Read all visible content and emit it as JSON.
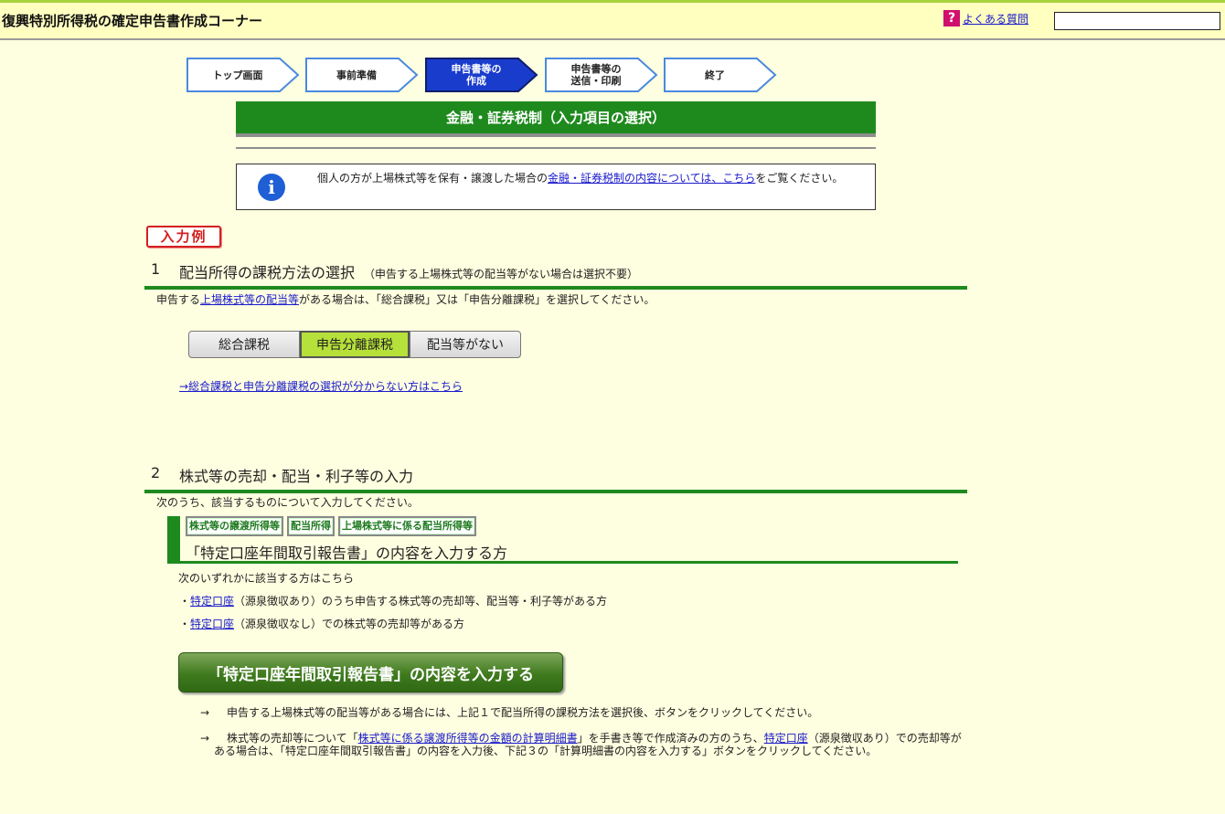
{
  "header": {
    "title": "復興特別所得税の確定申告書作成コーナー",
    "faq_label": "よくある質問",
    "search_value": ""
  },
  "steps": [
    {
      "label": "トップ画面",
      "active": false
    },
    {
      "label": "事前準備",
      "active": false
    },
    {
      "label": "申告書等の\n作成",
      "active": true
    },
    {
      "label": "申告書等の\n送信・印刷",
      "active": false
    },
    {
      "label": "終了",
      "active": false
    }
  ],
  "page_title": "金融・証券税制（入力項目の選択）",
  "info": {
    "text_before": "個人の方が上場株式等を保有・譲渡した場合の",
    "link": "金融・証券税制の内容については、こちら",
    "text_after": "をご覧ください。"
  },
  "example_badge": "入力例",
  "section1": {
    "number": "1",
    "heading": "配当所得の課税方法の選択",
    "note": "（申告する上場株式等の配当等がない場合は選択不要）",
    "desc_before": "申告する",
    "desc_link": "上場株式等の配当等",
    "desc_after": "がある場合は、「総合課税」又は「申告分離課税」を選択してください。",
    "options": [
      "総合課税",
      "申告分離課税",
      "配当等がない"
    ],
    "selected": "申告分離課税",
    "help_link": "→総合課税と申告分離課税の選択が分からない方はこちら"
  },
  "section2": {
    "number": "2",
    "heading": "株式等の売却・配当・利子等の入力",
    "desc": "次のうち、該当するものについて入力してください。",
    "tags": [
      "株式等の譲渡所得等",
      "配当所得",
      "上場株式等に係る配当所得等"
    ],
    "subheading": "「特定口座年間取引報告書」の内容を入力する方",
    "conditions_intro": "次のいずれかに該当する方はこちら",
    "cond1_prefix": "・",
    "cond1_link": "特定口座",
    "cond1_text": "（源泉徴収あり）のうち申告する株式等の売却等、配当等・利子等がある方",
    "cond2_prefix": "・",
    "cond2_link": "特定口座",
    "cond2_text": "（源泉徴収なし）での株式等の売却等がある方",
    "button": "「特定口座年間取引報告書」の内容を入力する",
    "note1": "申告する上場株式等の配当等がある場合には、上記１で配当所得の課税方法を選択後、ボタンをクリックしてください。",
    "note2_before": "株式等の売却等について「",
    "note2_link1": "株式等に係る譲渡所得等の金額の計算明細書",
    "note2_mid": "」を手書き等で作成済みの方のうち、",
    "note2_link2": "特定口座",
    "note2_after": "（源泉徴収あり）での売却等がある場合は、「特定口座年間取引報告書」の内容を入力後、下記３の「計算明細書の内容を入力する」ボタンをクリックしてください。",
    "arrow": "→"
  }
}
